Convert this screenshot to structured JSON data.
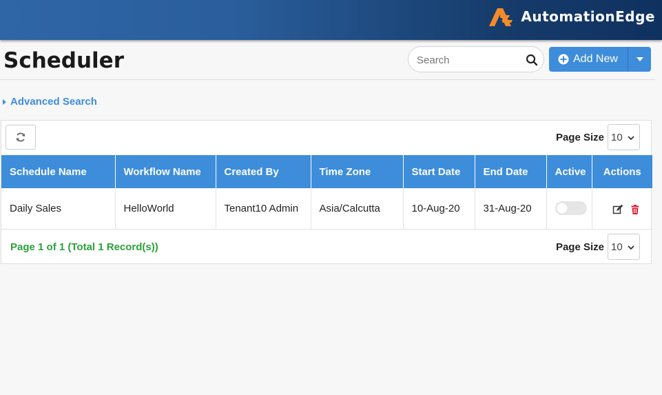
{
  "brand": {
    "name": "AutomationEdge",
    "accent": "#f58a2a"
  },
  "page": {
    "title": "Scheduler"
  },
  "search": {
    "placeholder": "Search",
    "value": "",
    "icon": "search-icon"
  },
  "add_button": {
    "label": "Add New",
    "icon": "plus-circle-icon",
    "dropdown_icon": "caret-down-icon",
    "color": "#3d8ddb"
  },
  "advanced_search": {
    "label": "Advanced Search"
  },
  "toolbar": {
    "refresh_icon": "refresh-icon",
    "page_size_label": "Page Size",
    "page_size_value": "10"
  },
  "table": {
    "columns": [
      "Schedule Name",
      "Workflow Name",
      "Created By",
      "Time Zone",
      "Start Date",
      "End Date",
      "Active",
      "Actions"
    ],
    "rows": [
      {
        "schedule_name": "Daily Sales",
        "workflow_name": "HelloWorld",
        "created_by": "Tenant10 Admin",
        "time_zone": "Asia/Calcutta",
        "start_date": "10-Aug-20",
        "end_date": "31-Aug-20",
        "active": false,
        "actions": [
          "edit-icon",
          "delete-icon"
        ]
      }
    ]
  },
  "footer": {
    "status": "Page 1 of 1 (Total 1 Record(s))",
    "status_color": "#2aa13b",
    "page_size_label": "Page Size",
    "page_size_value": "10"
  }
}
